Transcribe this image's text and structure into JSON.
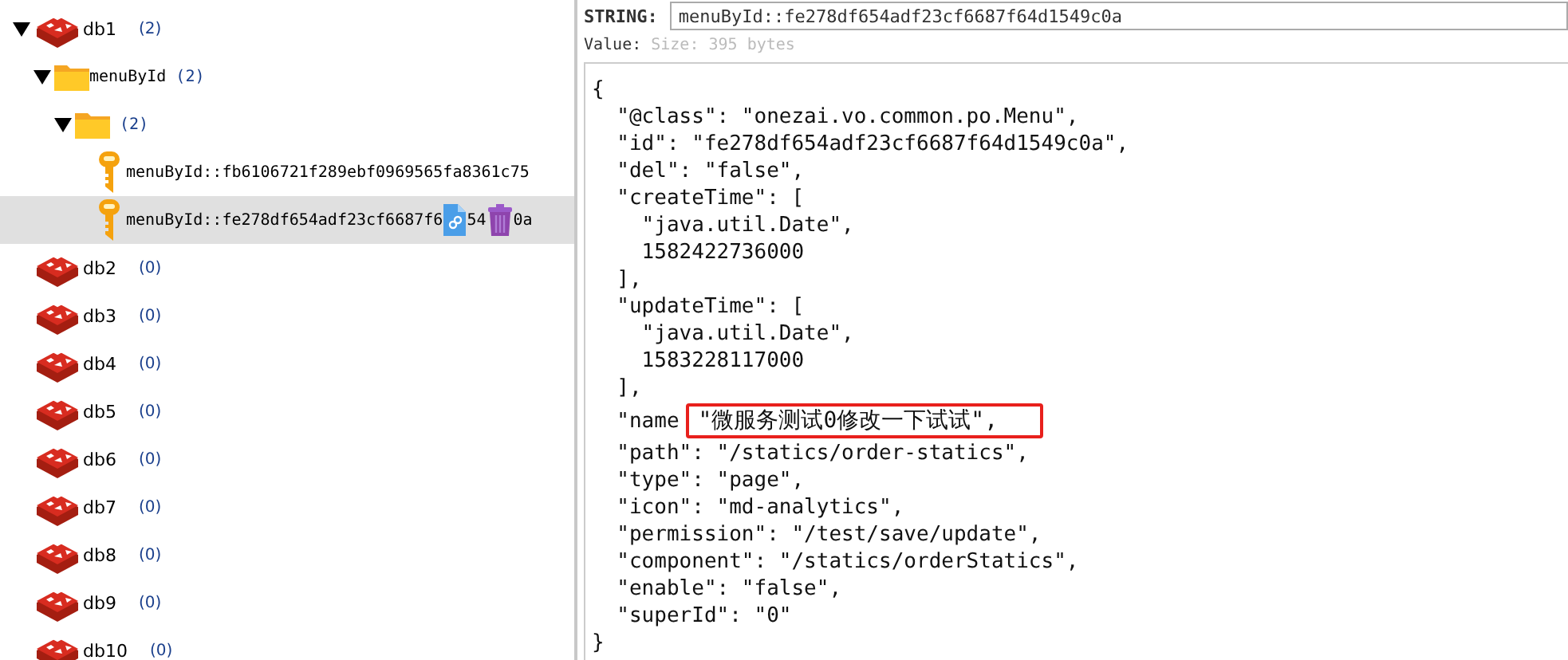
{
  "tree": [
    {
      "kind": "db",
      "label": "db1",
      "count": "(2)",
      "expanded": true,
      "selected": false,
      "children": [
        {
          "kind": "folder",
          "label": "menuById",
          "count": "(2)",
          "expanded": true,
          "selected": false,
          "children": [
            {
              "kind": "folder",
              "count": "(2)",
              "expanded": true,
              "selected": false,
              "children": [
                {
                  "kind": "key",
                  "label": "menuById::fb6106721f289ebf0969565fa8361c75",
                  "selected": false
                },
                {
                  "kind": "key",
                  "label": "menuById::fe278df654adf23cf6687f6",
                  "label_parts": [
                    "54",
                    "0a"
                  ],
                  "selected": true
                }
              ]
            }
          ]
        }
      ]
    },
    {
      "kind": "db",
      "label": "db2",
      "count": "(0)",
      "expanded": false,
      "selected": false
    },
    {
      "kind": "db",
      "label": "db3",
      "count": "(0)",
      "expanded": false,
      "selected": false
    },
    {
      "kind": "db",
      "label": "db4",
      "count": "(0)",
      "expanded": false,
      "selected": false
    },
    {
      "kind": "db",
      "label": "db5",
      "count": "(0)",
      "expanded": false,
      "selected": false
    },
    {
      "kind": "db",
      "label": "db6",
      "count": "(0)",
      "expanded": false,
      "selected": false
    },
    {
      "kind": "db",
      "label": "db7",
      "count": "(0)",
      "expanded": false,
      "selected": false
    },
    {
      "kind": "db",
      "label": "db8",
      "count": "(0)",
      "expanded": false,
      "selected": false
    },
    {
      "kind": "db",
      "label": "db9",
      "count": "(0)",
      "expanded": false,
      "selected": false
    },
    {
      "kind": "db",
      "label": "db10",
      "count": "(0)",
      "expanded": false,
      "selected": false
    }
  ],
  "detail": {
    "type_label": "STRING:",
    "key_value": "menuById::fe278df654adf23cf6687f64d1549c0a",
    "value_label": "Value:",
    "size": "Size: 395 bytes",
    "lines": [
      {
        "kind": "plain",
        "text": "{"
      },
      {
        "kind": "plain",
        "text": "  \"@class\": \"onezai.vo.common.po.Menu\","
      },
      {
        "kind": "plain",
        "text": "  \"id\": \"fe278df654adf23cf6687f64d1549c0a\","
      },
      {
        "kind": "plain",
        "text": "  \"del\": \"false\","
      },
      {
        "kind": "plain",
        "text": "  \"createTime\": ["
      },
      {
        "kind": "plain",
        "text": "    \"java.util.Date\","
      },
      {
        "kind": "plain",
        "text": "    1582422736000"
      },
      {
        "kind": "plain",
        "text": "  ],"
      },
      {
        "kind": "plain",
        "text": "  \"updateTime\": ["
      },
      {
        "kind": "plain",
        "text": "    \"java.util.Date\","
      },
      {
        "kind": "plain",
        "text": "    1583228117000"
      },
      {
        "kind": "plain",
        "text": "  ],"
      },
      {
        "kind": "highlighted",
        "text": "  \"name",
        "value": "\"微服务测试0修改一下试试\","
      },
      {
        "kind": "plain",
        "text": "  \"path\": \"/statics/order-statics\","
      },
      {
        "kind": "plain",
        "text": "  \"type\": \"page\","
      },
      {
        "kind": "plain",
        "text": "  \"icon\": \"md-analytics\","
      },
      {
        "kind": "plain",
        "text": "  \"permission\": \"/test/save/update\","
      },
      {
        "kind": "plain",
        "text": "  \"component\": \"/statics/orderStatics\","
      },
      {
        "kind": "plain",
        "text": "  \"enable\": \"false\","
      },
      {
        "kind": "plain",
        "text": "  \"superId\": \"0\""
      },
      {
        "kind": "plain",
        "text": "}"
      }
    ]
  }
}
